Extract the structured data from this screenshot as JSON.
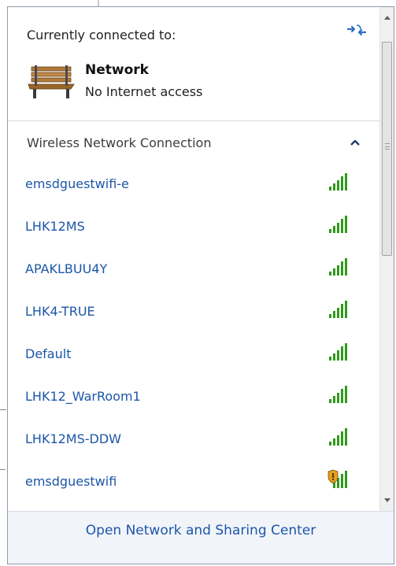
{
  "header": {
    "title": "Currently connected to:",
    "refresh_icon": "refresh-icon",
    "connection": {
      "icon": "bench-network-icon",
      "name": "Network",
      "status": "No Internet access"
    }
  },
  "section": {
    "title": "Wireless Network Connection",
    "toggle_icon": "chevron-up-icon"
  },
  "networks": [
    {
      "name": "emsdguestwifi-e",
      "signal_icon": "signal-bars-icon",
      "secured": false
    },
    {
      "name": "LHK12MS",
      "signal_icon": "signal-bars-icon",
      "secured": false
    },
    {
      "name": "APAKLBUU4Y",
      "signal_icon": "signal-bars-icon",
      "secured": false
    },
    {
      "name": "LHK4-TRUE",
      "signal_icon": "signal-bars-icon",
      "secured": false
    },
    {
      "name": "Default",
      "signal_icon": "signal-bars-icon",
      "secured": false
    },
    {
      "name": "LHK12_WarRoom1",
      "signal_icon": "signal-bars-icon",
      "secured": false
    },
    {
      "name": "LHK12MS-DDW",
      "signal_icon": "signal-bars-icon",
      "secured": false
    },
    {
      "name": "emsdguestwifi",
      "signal_icon": "signal-bars-shield-icon",
      "secured": true
    }
  ],
  "footer": {
    "link": "Open Network and Sharing Center"
  },
  "colors": {
    "link": "#1c56a8",
    "signal": "#2f9a1a",
    "panel_border": "#8f9aa8",
    "footer_bg": "#f1f4f9"
  }
}
